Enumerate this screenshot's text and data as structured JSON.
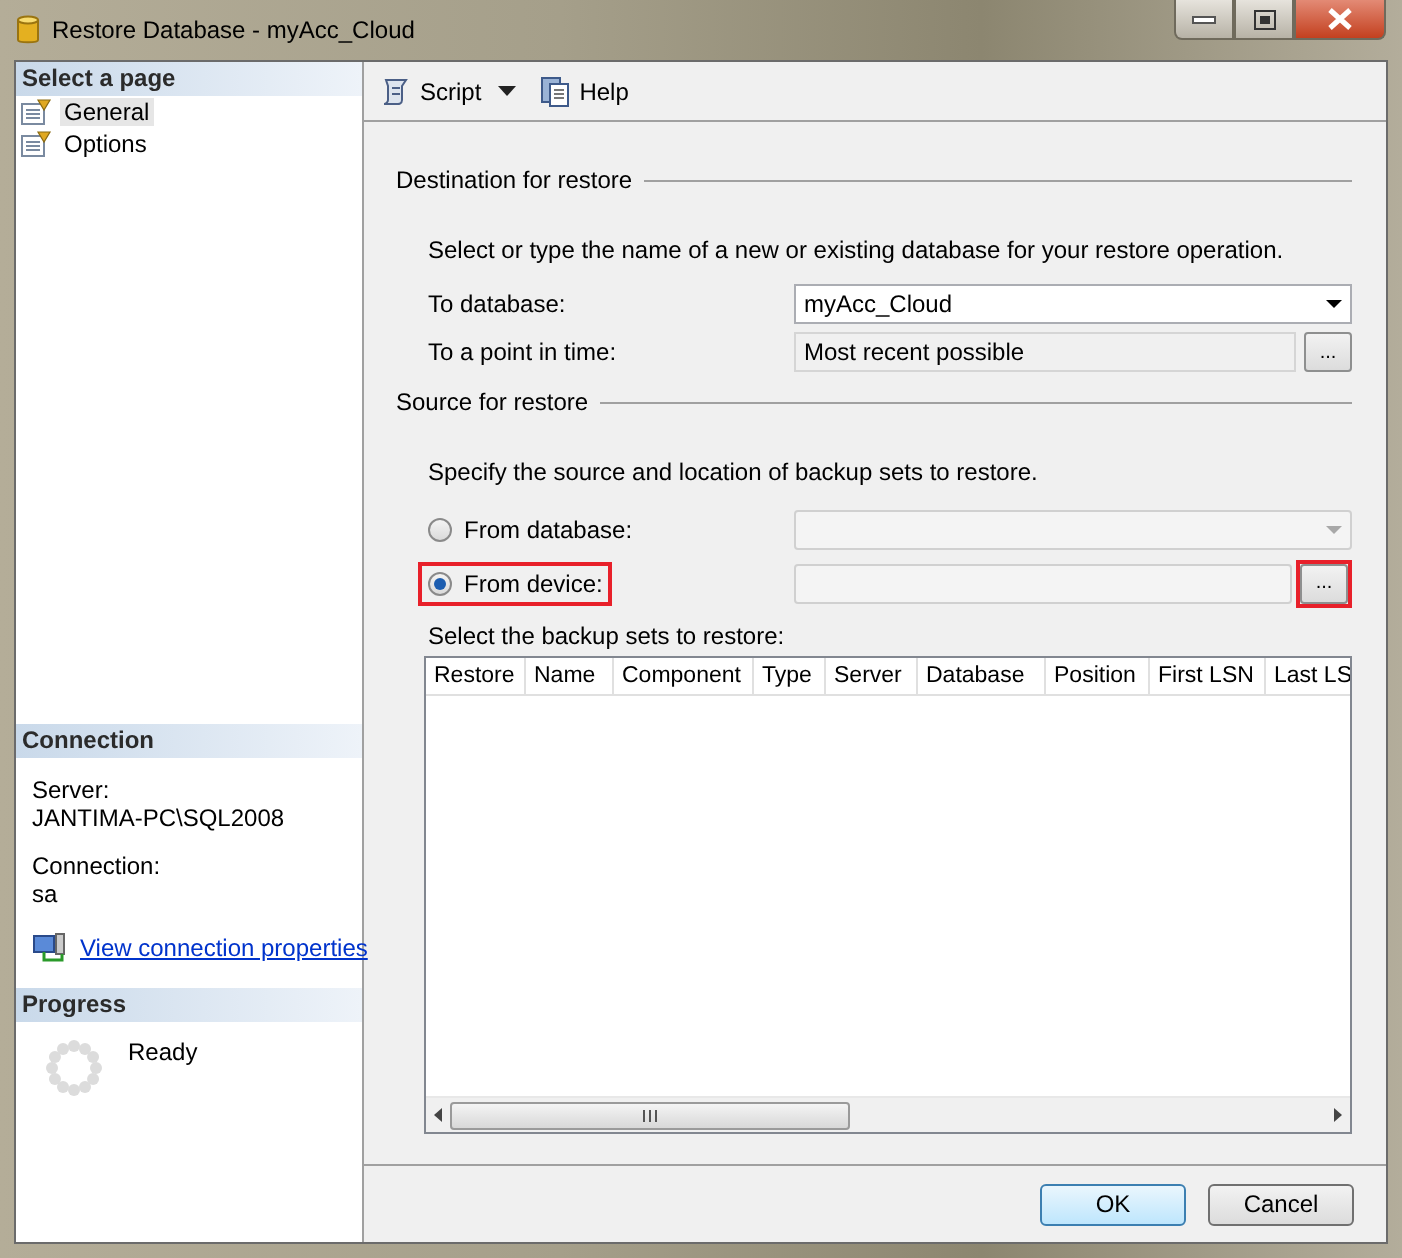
{
  "window": {
    "title": "Restore Database - myAcc_Cloud"
  },
  "sidebar": {
    "header": "Select a page",
    "pages": [
      {
        "label": "General",
        "selected": true
      },
      {
        "label": "Options",
        "selected": false
      }
    ],
    "connection": {
      "header": "Connection",
      "server_label": "Server:",
      "server": "JANTIMA-PC\\SQL2008",
      "connection_label": "Connection:",
      "connection": "sa",
      "link": "View connection properties"
    },
    "progress": {
      "header": "Progress",
      "status": "Ready"
    }
  },
  "toolbar": [
    {
      "label": "Script",
      "kind": "script"
    },
    {
      "label": "Help",
      "kind": "help"
    }
  ],
  "destination": {
    "heading": "Destination for restore",
    "instruction": "Select or type the name of a new or existing database for your restore operation.",
    "to_database": {
      "label": "To database:",
      "value": "myAcc_Cloud"
    },
    "point_in_time": {
      "label": "To a point in time:",
      "value": "Most recent possible",
      "button": "..."
    }
  },
  "source": {
    "heading": "Source for restore",
    "instruction": "Specify the source and location of backup sets to restore.",
    "options": [
      {
        "label": "From database:",
        "selected": false,
        "highlighted": false,
        "kind": "dropdown"
      },
      {
        "label": "From device:",
        "selected": true,
        "highlighted": true,
        "kind": "browse",
        "button": "...",
        "button_highlighted": true
      }
    ]
  },
  "backup_sets": {
    "label": "Select the backup sets to restore:",
    "columns": [
      "Restore",
      "Name",
      "Component",
      "Type",
      "Server",
      "Database",
      "Position",
      "First LSN",
      "Last LS"
    ]
  },
  "buttons": [
    {
      "label": "OK",
      "default": true
    },
    {
      "label": "Cancel",
      "default": false
    }
  ]
}
